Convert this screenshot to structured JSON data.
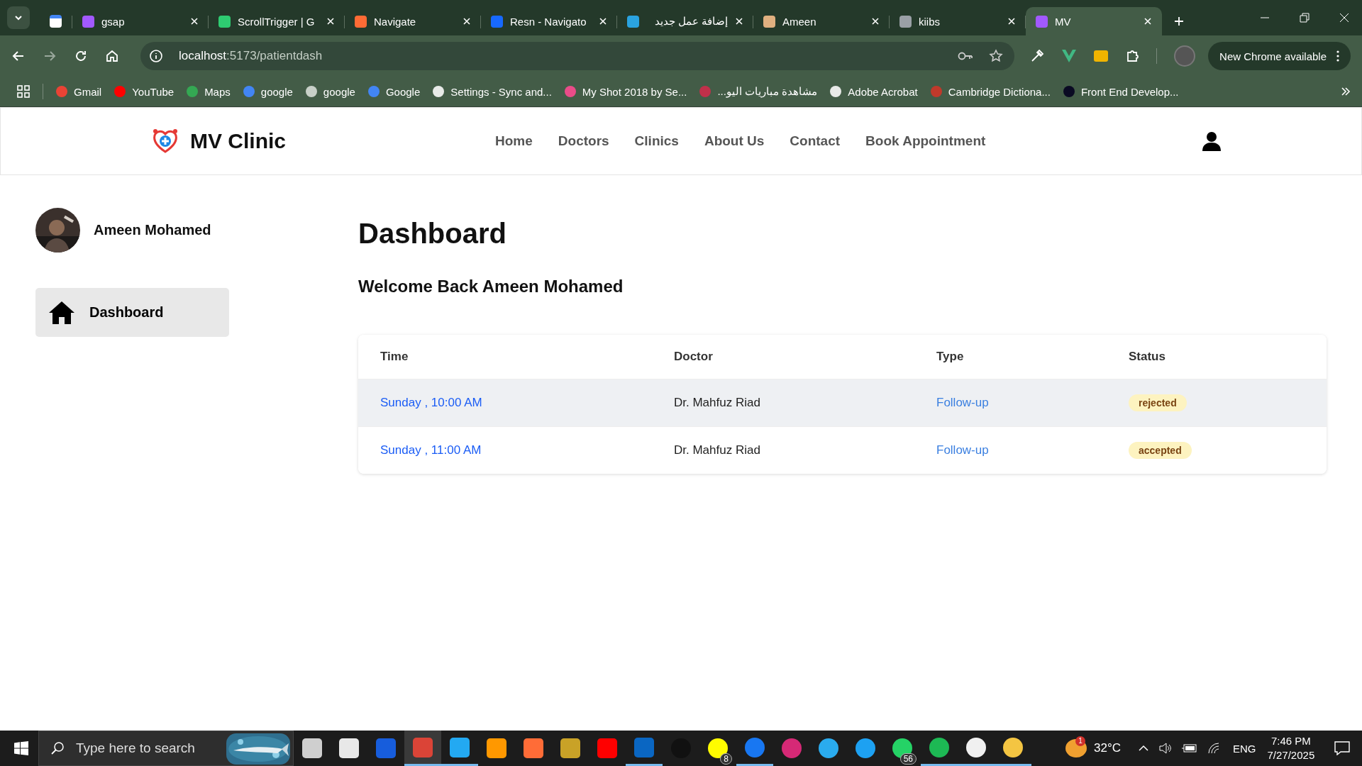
{
  "browser": {
    "tabs": [
      {
        "pinned": true,
        "selected": false
      },
      {
        "title": "gsap",
        "pinned": false,
        "selected": false
      },
      {
        "title": "ScrollTrigger | G",
        "pinned": false,
        "selected": false
      },
      {
        "title": "Navigate",
        "pinned": false,
        "selected": false
      },
      {
        "title": "Resn - Navigato",
        "pinned": false,
        "selected": false
      },
      {
        "title": "إضافة عمل جديد",
        "pinned": false,
        "selected": false
      },
      {
        "title": "Ameen",
        "pinned": false,
        "selected": false
      },
      {
        "title": "kiibs",
        "pinned": false,
        "selected": false
      },
      {
        "title": "MV",
        "pinned": false,
        "selected": true
      }
    ],
    "address": {
      "host": "localhost",
      "rest": ":5173/patientdash"
    },
    "update_button": "New Chrome available",
    "bookmarks": [
      "Gmail",
      "YouTube",
      "Maps",
      "google",
      "google",
      "Google",
      "Settings - Sync and...",
      "My Shot 2018 by Se...",
      "مشاهدة مباريات اليو...",
      "Adobe Acrobat",
      "Cambridge Dictiona...",
      "Front End Develop..."
    ]
  },
  "page": {
    "brand": "MV Clinic",
    "nav": [
      "Home",
      "Doctors",
      "Clinics",
      "About Us",
      "Contact",
      "Book Appointment"
    ],
    "user": {
      "name": "Ameen Mohamed"
    },
    "sidebar": [
      {
        "label": "Dashboard",
        "selected": true
      }
    ],
    "title": "Dashboard",
    "welcome": "Welcome Back Ameen Mohamed",
    "table": {
      "columns": [
        "Time",
        "Doctor",
        "Type",
        "Status"
      ],
      "rows": [
        {
          "time": "Sunday , 10:00 AM",
          "doctor": "Dr. Mahfuz Riad",
          "type": "Follow-up",
          "status": "rejected",
          "hovered": true
        },
        {
          "time": "Sunday , 11:00 AM",
          "doctor": "Dr. Mahfuz Riad",
          "type": "Follow-up",
          "status": "accepted",
          "hovered": false
        }
      ]
    }
  },
  "taskbar": {
    "search_placeholder": "Type here to search",
    "apps": [
      {
        "running": false,
        "selected": false
      },
      {
        "running": false,
        "selected": false
      },
      {
        "running": false,
        "selected": false
      },
      {
        "running": true,
        "selected": true
      },
      {
        "running": true,
        "selected": false
      },
      {
        "running": false,
        "selected": false
      },
      {
        "running": false,
        "selected": false
      },
      {
        "running": false,
        "selected": false
      },
      {
        "running": false,
        "selected": false
      },
      {
        "running": true,
        "selected": false
      },
      {
        "running": false,
        "selected": false
      },
      {
        "running": false,
        "selected": false,
        "badge": "8"
      },
      {
        "running": true,
        "selected": false
      },
      {
        "running": false,
        "selected": false
      },
      {
        "running": false,
        "selected": false
      },
      {
        "running": false,
        "selected": false
      },
      {
        "running": false,
        "selected": false,
        "badge": "56"
      },
      {
        "running": true,
        "selected": false
      },
      {
        "running": true,
        "selected": false
      },
      {
        "running": true,
        "selected": false
      }
    ],
    "weather": {
      "badge": "1",
      "temp": "32°C"
    },
    "language": "ENG",
    "time": "7:46 PM",
    "date": "7/27/2025"
  }
}
